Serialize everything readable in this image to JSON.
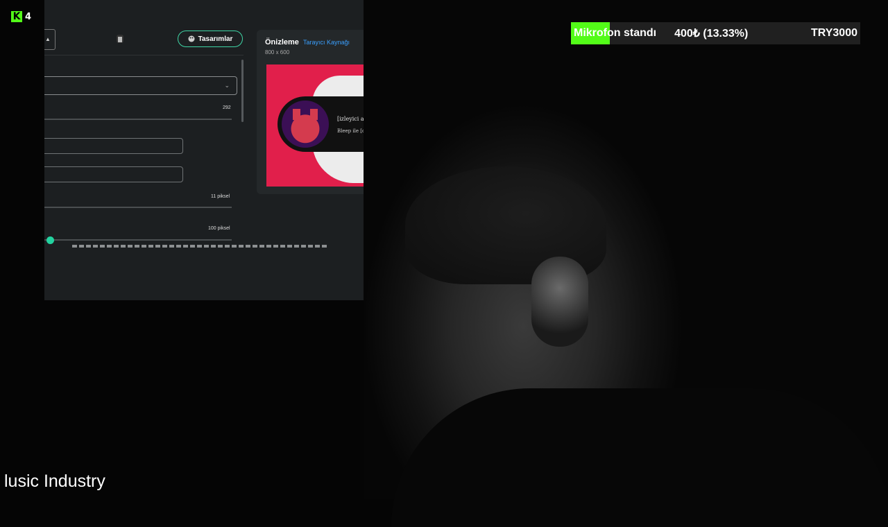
{
  "kick": {
    "viewer_count": "4"
  },
  "editor": {
    "designs_button_label": "Tasarımlar",
    "select_value": "",
    "slider1_value": "292",
    "slider2_value": "11 piksel",
    "slider3_value": "100 piksel"
  },
  "preview": {
    "title": "Önizleme",
    "source_label": "Tarayıcı Kaynağı",
    "size": "800 x 600",
    "alert_line1": "[izleyici adı] [",
    "alert_line2": "Bleep ile [oyun"
  },
  "goal": {
    "name": "Mikrofon standı",
    "progress_text": "400₺ (13.33%)",
    "target_text": "TRY3000",
    "fraction": 0.1333,
    "fill_color": "#53fc18"
  },
  "now_playing": {
    "text": "lusic Industry"
  },
  "colors": {
    "accent": "#3fd6a6",
    "kick_green": "#53fc18",
    "preview_red": "#e11f4b"
  }
}
